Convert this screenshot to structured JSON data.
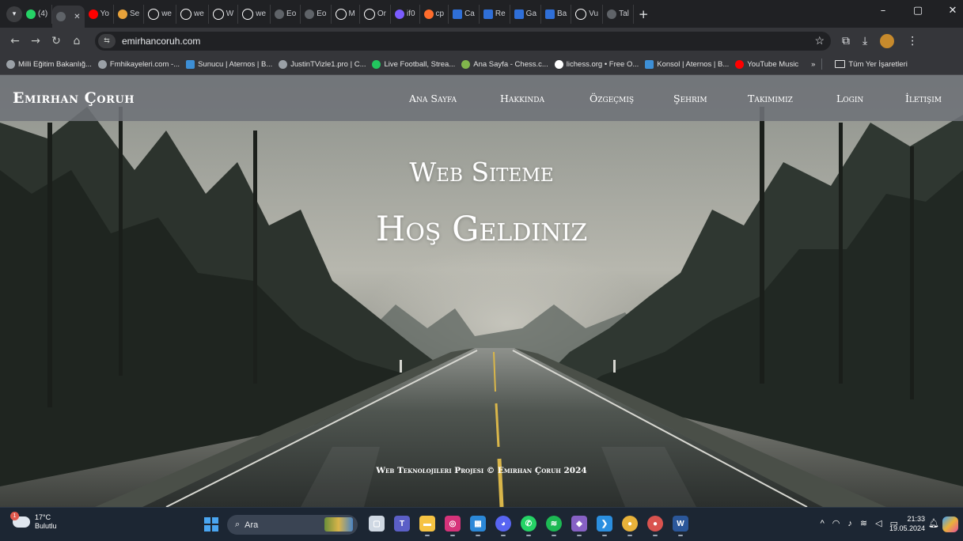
{
  "browser": {
    "tab_menu_icon": "chevron-down-icon",
    "tabs": [
      {
        "label": "(4)",
        "icon": "whatsapp-icon",
        "color": "#25d366"
      },
      {
        "label": "",
        "icon": "globe-icon",
        "color": "#5f6368",
        "active": true
      },
      {
        "label": "Yo",
        "icon": "youtube-music-icon",
        "color": "#ff0000"
      },
      {
        "label": "Se",
        "icon": "site-icon",
        "color": "#e8a23a"
      },
      {
        "label": "we",
        "icon": "github-icon",
        "color": "#ffffff"
      },
      {
        "label": "we",
        "icon": "github-icon",
        "color": "#ffffff"
      },
      {
        "label": "W",
        "icon": "github-icon",
        "color": "#ffffff"
      },
      {
        "label": "we",
        "icon": "github-icon",
        "color": "#ffffff"
      },
      {
        "label": "Eo",
        "icon": "globe-icon",
        "color": "#5f6368"
      },
      {
        "label": "Eo",
        "icon": "globe-icon",
        "color": "#5f6368"
      },
      {
        "label": "M",
        "icon": "github-icon",
        "color": "#ffffff"
      },
      {
        "label": "Or",
        "icon": "openai-icon",
        "color": "#ffffff"
      },
      {
        "label": "if0",
        "icon": "infinity-icon",
        "color": "#7b5cff"
      },
      {
        "label": "cp",
        "icon": "cpanel-icon",
        "color": "#ff6c2c"
      },
      {
        "label": "Ca",
        "icon": "m-icon",
        "color": "#2f6fd8"
      },
      {
        "label": "Re",
        "icon": "m-icon",
        "color": "#2f6fd8"
      },
      {
        "label": "Ga",
        "icon": "m-icon",
        "color": "#2f6fd8"
      },
      {
        "label": "Ba",
        "icon": "m-icon",
        "color": "#2f6fd8"
      },
      {
        "label": "Vu",
        "icon": "openai-icon",
        "color": "#ffffff"
      },
      {
        "label": "Tal",
        "icon": "globe-icon",
        "color": "#5f6368"
      }
    ],
    "new_tab_label": "+",
    "window_controls": [
      "–",
      "▢",
      "✕"
    ],
    "url": "emirhancoruh.com",
    "bookmarks": [
      {
        "label": "Milli Eğitim Bakanlığ...",
        "icon": "globe-icon",
        "color": "#9aa0a6"
      },
      {
        "label": "Fmhikayeleri.com -...",
        "icon": "globe-icon",
        "color": "#9aa0a6"
      },
      {
        "label": "Sunucu | Aternos | B...",
        "icon": "aternos-icon",
        "color": "#3d8fd6"
      },
      {
        "label": "JustinTVizle1.pro | C...",
        "icon": "globe-icon",
        "color": "#9aa0a6"
      },
      {
        "label": "Live Football, Strea...",
        "icon": "football-icon",
        "color": "#22c55e"
      },
      {
        "label": "Ana Sayfa - Chess.c...",
        "icon": "chess-icon",
        "color": "#81b64c"
      },
      {
        "label": "lichess.org • Free O...",
        "icon": "lichess-icon",
        "color": "#ffffff"
      },
      {
        "label": "Konsol | Aternos | B...",
        "icon": "aternos-icon",
        "color": "#3d8fd6"
      },
      {
        "label": "YouTube Music",
        "icon": "youtube-music-icon",
        "color": "#ff0000"
      }
    ],
    "bookmarks_more": "»",
    "all_bookmarks": "Tüm Yer İşaretleri"
  },
  "site": {
    "brand": "Emirhan Çoruh",
    "nav": [
      "Ana Sayfa",
      "Hakkında",
      "Özgeçmiş",
      "Şehrim",
      "Takımımız",
      "Login",
      "İletişim"
    ],
    "hero_line1": "Web Siteme",
    "hero_line2": "Hoş Geldiniz",
    "footer": "Web Teknolojileri Projesi © Emirhan Çoruh 2024"
  },
  "taskbar": {
    "temperature": "17°C",
    "condition": "Bulutlu",
    "weather_badge": "1",
    "search_placeholder": "Ara",
    "apps": [
      {
        "name": "task-view-icon",
        "label": "▢",
        "color": "#cfd8e3"
      },
      {
        "name": "teams-icon",
        "label": "T",
        "color": "#5b5fc7"
      },
      {
        "name": "file-explorer-icon",
        "label": "▬",
        "color": "#f6c343"
      },
      {
        "name": "instagram-icon",
        "label": "◎",
        "color": "#d6337a"
      },
      {
        "name": "store-icon",
        "label": "▦",
        "color": "#2b88d8"
      },
      {
        "name": "discord-icon",
        "label": "◕",
        "color": "#5865f2"
      },
      {
        "name": "whatsapp-icon",
        "label": "✆",
        "color": "#25d366"
      },
      {
        "name": "spotify-icon",
        "label": "≋",
        "color": "#1db954"
      },
      {
        "name": "visual-studio-icon",
        "label": "◆",
        "color": "#8661c5"
      },
      {
        "name": "vscode-icon",
        "label": "❯",
        "color": "#2b8fe0"
      },
      {
        "name": "chrome-icon",
        "label": "●",
        "color": "#e8b23a"
      },
      {
        "name": "chrome-profile-icon",
        "label": "●",
        "color": "#d9534f"
      },
      {
        "name": "word-icon",
        "label": "W",
        "color": "#2b579a"
      }
    ],
    "tray": [
      "^",
      "◠",
      "♪",
      "≋",
      "◁",
      "▭"
    ],
    "time": "21:33",
    "date": "19.05.2024"
  }
}
